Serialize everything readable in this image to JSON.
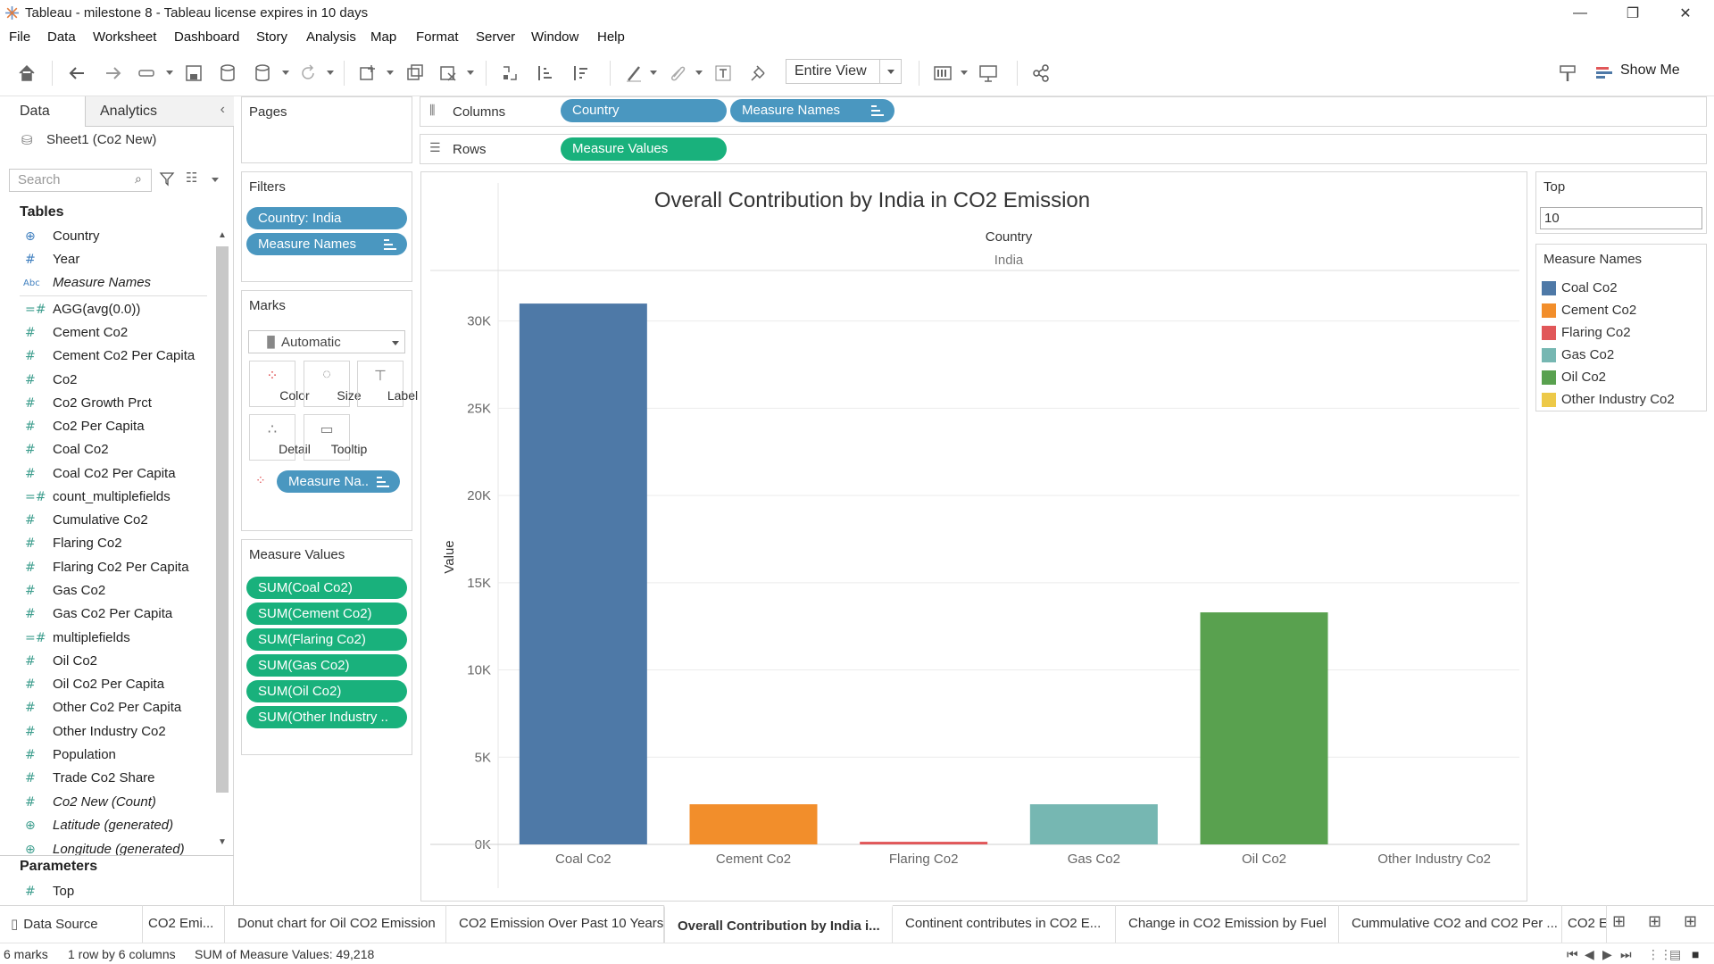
{
  "window": {
    "title": "Tableau - milestone 8 - Tableau license expires in 10 days",
    "controls": [
      "—",
      "❐",
      "✕"
    ]
  },
  "menu": [
    "File",
    "Data",
    "Worksheet",
    "Dashboard",
    "Story",
    "Analysis",
    "Map",
    "Format",
    "Server",
    "Window",
    "Help"
  ],
  "toolbar": {
    "fit": "Entire View",
    "show_me": "Show Me"
  },
  "left_pane": {
    "tabs": [
      "Data",
      "Analytics"
    ],
    "datasource": "Sheet1 (Co2 New)",
    "search_placeholder": "Search",
    "tables_header": "Tables",
    "fields": [
      {
        "icon": "⊕",
        "label": "Country",
        "type": "dim"
      },
      {
        "icon": "#",
        "label": "Year",
        "type": "dim"
      },
      {
        "icon": "Abc",
        "label": "Measure Names",
        "type": "dim",
        "italic": true
      },
      {
        "icon": "=#",
        "label": "AGG(avg(0.0))",
        "type": "measure"
      },
      {
        "icon": "#",
        "label": "Cement Co2",
        "type": "measure"
      },
      {
        "icon": "#",
        "label": "Cement Co2 Per Capita",
        "type": "measure"
      },
      {
        "icon": "#",
        "label": "Co2",
        "type": "measure"
      },
      {
        "icon": "#",
        "label": "Co2 Growth Prct",
        "type": "measure"
      },
      {
        "icon": "#",
        "label": "Co2 Per Capita",
        "type": "measure"
      },
      {
        "icon": "#",
        "label": "Coal Co2",
        "type": "measure"
      },
      {
        "icon": "#",
        "label": "Coal Co2 Per Capita",
        "type": "measure"
      },
      {
        "icon": "=#",
        "label": "count_multiplefields",
        "type": "measure"
      },
      {
        "icon": "#",
        "label": "Cumulative Co2",
        "type": "measure"
      },
      {
        "icon": "#",
        "label": "Flaring Co2",
        "type": "measure"
      },
      {
        "icon": "#",
        "label": "Flaring Co2 Per Capita",
        "type": "measure"
      },
      {
        "icon": "#",
        "label": "Gas Co2",
        "type": "measure"
      },
      {
        "icon": "#",
        "label": "Gas Co2 Per Capita",
        "type": "measure"
      },
      {
        "icon": "=#",
        "label": "multiplefields",
        "type": "measure"
      },
      {
        "icon": "#",
        "label": "Oil Co2",
        "type": "measure"
      },
      {
        "icon": "#",
        "label": "Oil Co2 Per Capita",
        "type": "measure"
      },
      {
        "icon": "#",
        "label": "Other Co2 Per Capita",
        "type": "measure"
      },
      {
        "icon": "#",
        "label": "Other Industry Co2",
        "type": "measure"
      },
      {
        "icon": "#",
        "label": "Population",
        "type": "measure"
      },
      {
        "icon": "#",
        "label": "Trade Co2 Share",
        "type": "measure"
      },
      {
        "icon": "#",
        "label": "Co2 New (Count)",
        "type": "measure",
        "italic": true
      },
      {
        "icon": "⊕",
        "label": "Latitude (generated)",
        "type": "measure",
        "italic": true
      },
      {
        "icon": "⊕",
        "label": "Longitude (generated)",
        "type": "measure",
        "italic": true
      }
    ],
    "parameters_header": "Parameters",
    "parameters": [
      {
        "icon": "#",
        "label": "Top"
      }
    ]
  },
  "shelves": {
    "pages": "Pages",
    "filters": "Filters",
    "filter_pills": [
      "Country: India",
      "Measure Names"
    ],
    "marks": "Marks",
    "mark_type": "Automatic",
    "mark_buttons": [
      "Color",
      "Size",
      "Label",
      "Detail",
      "Tooltip"
    ],
    "color_pill": "Measure Na..",
    "measure_values_title": "Measure Values",
    "measure_values": [
      "SUM(Coal Co2)",
      "SUM(Cement Co2)",
      "SUM(Flaring Co2)",
      "SUM(Gas Co2)",
      "SUM(Oil Co2)",
      "SUM(Other Industry .."
    ],
    "columns_label": "Columns",
    "columns": [
      "Country",
      "Measure Names"
    ],
    "rows_label": "Rows",
    "rows": [
      "Measure Values"
    ]
  },
  "right_pane": {
    "top_title": "Top",
    "top_value": "10",
    "legend_title": "Measure Names"
  },
  "chart_data": {
    "type": "bar",
    "title": "Overall Contribution by India in CO2 Emission",
    "header_field": "Country",
    "header_value": "India",
    "ylabel": "Value",
    "categories": [
      "Coal Co2",
      "Cement Co2",
      "Flaring Co2",
      "Gas Co2",
      "Oil Co2",
      "Other Industry Co2"
    ],
    "values": [
      31000,
      2300,
      150,
      2300,
      13300,
      0
    ],
    "colors": [
      "#4e79a7",
      "#f28e2b",
      "#e15759",
      "#76b7b2",
      "#59a14f",
      "#edc948"
    ],
    "yticks": [
      "0K",
      "5K",
      "10K",
      "15K",
      "20K",
      "25K",
      "30K"
    ],
    "ylim": [
      0,
      33000
    ],
    "grid": true
  },
  "tabs": {
    "datasource": "Data Source",
    "sheets": [
      "CO2 Emi...",
      "Donut chart for Oil CO2 Emission",
      "CO2 Emission Over Past 10 Years",
      "Overall Contribution by India i...",
      "Continent contributes in CO2 E...",
      "Change in CO2 Emission by Fuel",
      "Cummulative CO2 and CO2 Per ...",
      "CO2 E"
    ],
    "active_index": 3
  },
  "status": {
    "marks": "6 marks",
    "dims": "1 row by 6 columns",
    "sum": "SUM of Measure Values: 49,218"
  }
}
